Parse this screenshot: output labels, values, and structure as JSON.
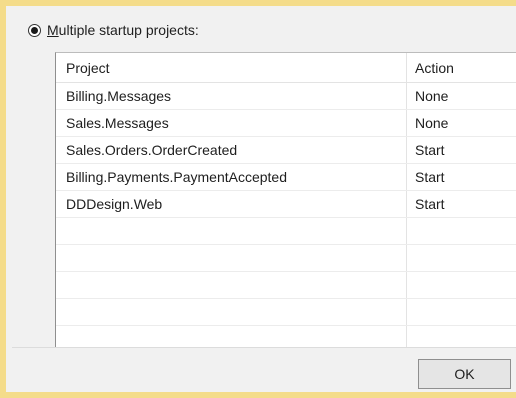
{
  "startup": {
    "option_label_first": "M",
    "option_label_rest": "ultiple startup projects:",
    "selected": true
  },
  "grid": {
    "columns": [
      "Project",
      "Action"
    ],
    "rows": [
      [
        "Billing.Messages",
        "None"
      ],
      [
        "Sales.Messages",
        "None"
      ],
      [
        "Sales.Orders.OrderCreated",
        "Start"
      ],
      [
        "Billing.Payments.PaymentAccepted",
        "Start"
      ],
      [
        "DDDesign.Web",
        "Start"
      ],
      [
        "",
        ""
      ],
      [
        "",
        ""
      ],
      [
        "",
        ""
      ],
      [
        "",
        ""
      ],
      [
        "",
        ""
      ]
    ]
  },
  "footer": {
    "ok_label": "OK"
  },
  "colors": {
    "frame_highlight": "#f4dc8a",
    "dialog_bg": "#f1f1f1",
    "grid_bg": "#ffffff"
  }
}
